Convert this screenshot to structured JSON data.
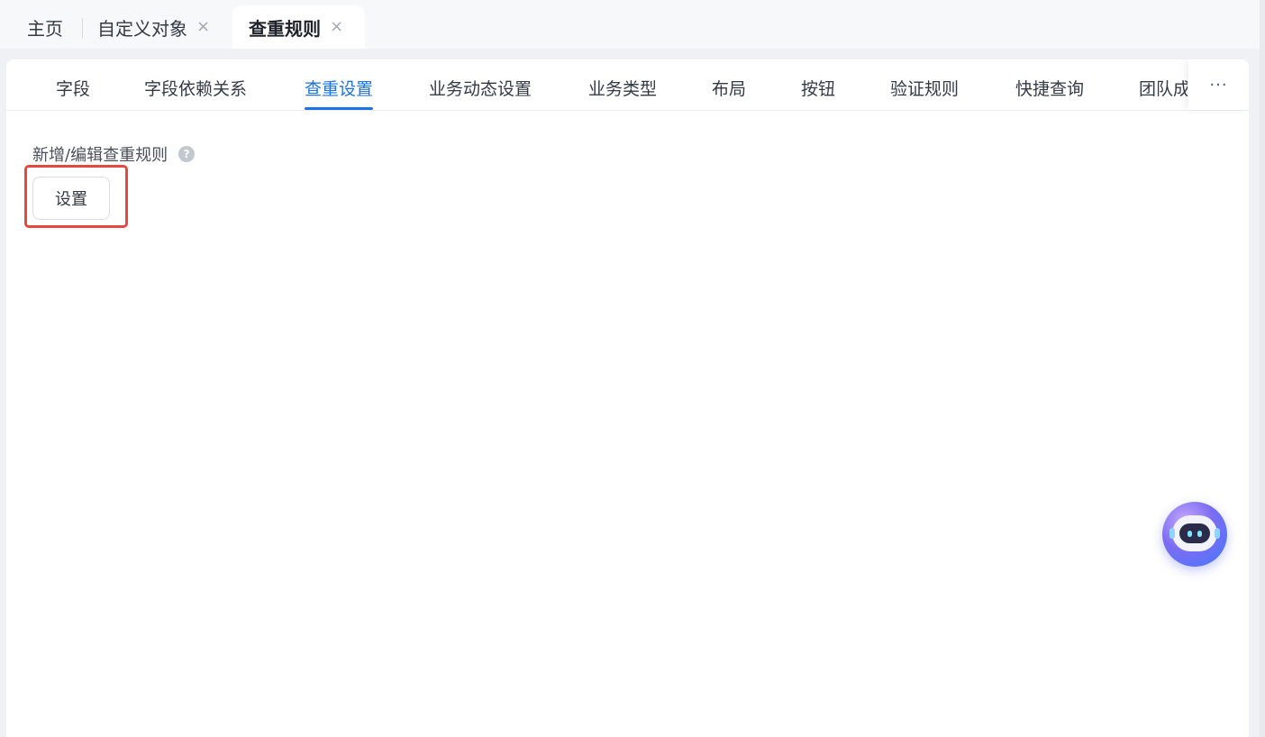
{
  "window_tabs": {
    "home": "主页",
    "custom_object": "自定义对象",
    "active": "查重规则",
    "close_glyph": "×"
  },
  "sub_tabs": {
    "items": [
      "字段",
      "字段依赖关系",
      "查重设置",
      "业务动态设置",
      "业务类型",
      "布局",
      "按钮",
      "验证规则",
      "快捷查询",
      "团队成"
    ],
    "active": "查重设置",
    "more": "···"
  },
  "content": {
    "section_label": "新增/编辑查重规则",
    "help_glyph": "?",
    "setting_button": "设置"
  },
  "colors": {
    "accent": "#1a73e8",
    "highlight": "#e5483f"
  },
  "icons": {
    "close": "close-icon",
    "help": "help-icon",
    "more": "more-icon",
    "assistant": "robot-assistant-icon"
  }
}
